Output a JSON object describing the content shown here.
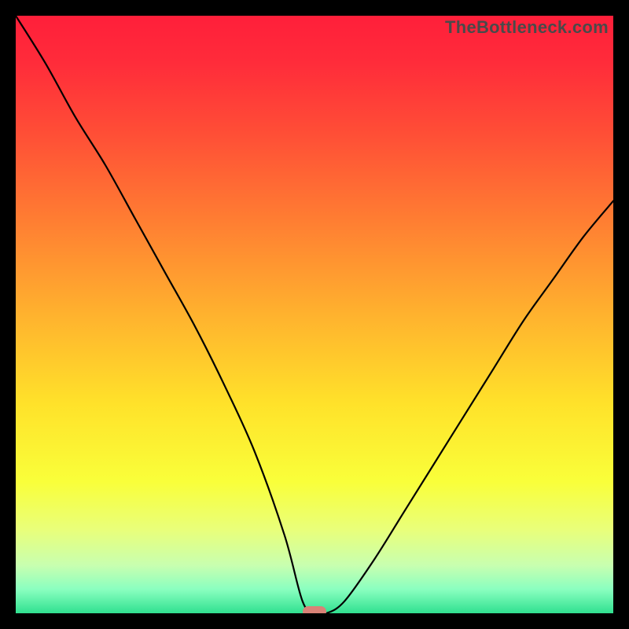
{
  "watermark": "TheBottleneck.com",
  "chart_data": {
    "type": "line",
    "title": "",
    "xlabel": "",
    "ylabel": "",
    "xlim": [
      0,
      100
    ],
    "ylim": [
      0,
      100
    ],
    "grid": false,
    "legend": false,
    "series": [
      {
        "name": "bottleneck-curve",
        "x": [
          0,
          5,
          10,
          15,
          20,
          25,
          30,
          35,
          40,
          45,
          48,
          50,
          52,
          55,
          60,
          65,
          70,
          75,
          80,
          85,
          90,
          95,
          100
        ],
        "y": [
          100,
          92,
          83,
          75,
          66,
          57,
          48,
          38,
          27,
          13,
          2,
          0,
          0,
          2,
          9,
          17,
          25,
          33,
          41,
          49,
          56,
          63,
          69
        ]
      }
    ],
    "marker": {
      "x": 50,
      "y": 0,
      "color": "#d98277",
      "label": "optimal-point"
    },
    "background_gradient": {
      "stops": [
        {
          "offset": 0.0,
          "color": "#ff1f3a"
        },
        {
          "offset": 0.08,
          "color": "#ff2c3a"
        },
        {
          "offset": 0.2,
          "color": "#ff4f36"
        },
        {
          "offset": 0.35,
          "color": "#ff8032"
        },
        {
          "offset": 0.5,
          "color": "#ffb22e"
        },
        {
          "offset": 0.65,
          "color": "#ffe22a"
        },
        {
          "offset": 0.78,
          "color": "#f9ff3a"
        },
        {
          "offset": 0.86,
          "color": "#e9ff7a"
        },
        {
          "offset": 0.92,
          "color": "#c8ffb0"
        },
        {
          "offset": 0.96,
          "color": "#8affc0"
        },
        {
          "offset": 1.0,
          "color": "#30e090"
        }
      ]
    }
  }
}
